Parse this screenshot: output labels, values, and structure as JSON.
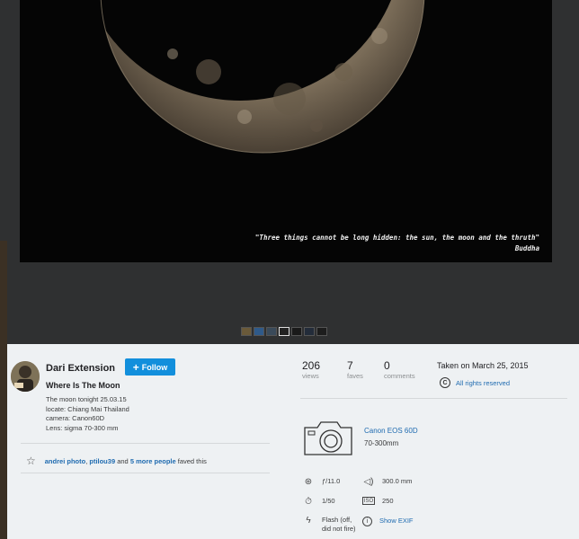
{
  "photo": {
    "quote_text": "\"Three things cannot be long hidden: the sun, the moon and the thruth\"",
    "quote_author": "Buddha"
  },
  "owner": {
    "name": "Dari Extension",
    "follow_label": "Follow"
  },
  "photo_info": {
    "title": "Where Is The Moon",
    "description": [
      "The moon tonight 25.03.15",
      "locate: Chiang Mai Thailand",
      "camera: Canon60D",
      "Lens: sigma 70-300 mm"
    ]
  },
  "faves": {
    "user1": "andrei photo",
    "sep": ", ",
    "user2": "ptilou39",
    "and": " and ",
    "more": "5 more people",
    "suffix": " faved this"
  },
  "stats": {
    "views": {
      "value": "206",
      "label": "views"
    },
    "faves": {
      "value": "7",
      "label": "faves"
    },
    "comments": {
      "value": "0",
      "label": "comments"
    }
  },
  "taken": "Taken on March 25, 2015",
  "rights": "All rights reserved",
  "camera": {
    "name": "Canon EOS 60D",
    "lens": "70-300mm"
  },
  "exif": {
    "aperture": "ƒ/11.0",
    "focal": "300.0 mm",
    "shutter": "1/50",
    "iso": "250",
    "flash_line1": "Flash (off,",
    "flash_line2": "did not fire)",
    "show_exif": "Show EXIF"
  },
  "icons": {
    "aperture": "aperture-icon",
    "focal": "focal-length-icon",
    "shutter": "stopwatch-icon",
    "iso": "iso-icon",
    "flash": "flash-icon",
    "info": "info-icon",
    "star": "star-icon",
    "copyright": "copyright-icon",
    "camera": "camera-icon"
  },
  "colors": {
    "accent": "#128fdc",
    "link": "#1f6bb0",
    "panel_bg": "#eef1f3",
    "viewer_bg": "#2f3031"
  }
}
